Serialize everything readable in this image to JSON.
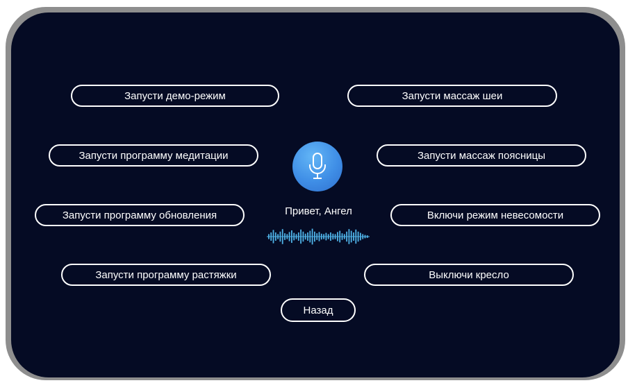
{
  "commands": {
    "demo_mode": "Запусти демо-режим",
    "neck_massage": "Запусти массаж шеи",
    "meditation": "Запусти программу медитации",
    "lower_back_massage": "Запусти массаж поясницы",
    "update": "Запусти программу обновления",
    "zero_gravity": "Включи режим невесомости",
    "stretching": "Запусти программу растяжки",
    "turn_off_chair": "Выключи кресло"
  },
  "back_label": "Назад",
  "greeting": "Привет, Ангел",
  "voice_wave": {
    "color": "#4fb3e8",
    "bar_levels": [
      0.3,
      0.5,
      0.8,
      0.5,
      0.3,
      0.6,
      0.9,
      0.4,
      0.3,
      0.55,
      0.75,
      0.45,
      0.3,
      0.5,
      0.85,
      0.6,
      0.35,
      0.5,
      0.7,
      0.95,
      0.6,
      0.4,
      0.55,
      0.35,
      0.3,
      0.45,
      0.3,
      0.5,
      0.35,
      0.3,
      0.55,
      0.7,
      0.4,
      0.3,
      0.6,
      0.9,
      0.7,
      0.5,
      0.85,
      0.6,
      0.45,
      0.3,
      0.2,
      0.15
    ]
  },
  "icons": {
    "mic": "microphone-icon"
  },
  "colors": {
    "frame": "#8e8e8e",
    "background": "#050b24",
    "mic_button": "#3f8ee6",
    "button_border": "#ffffff"
  }
}
